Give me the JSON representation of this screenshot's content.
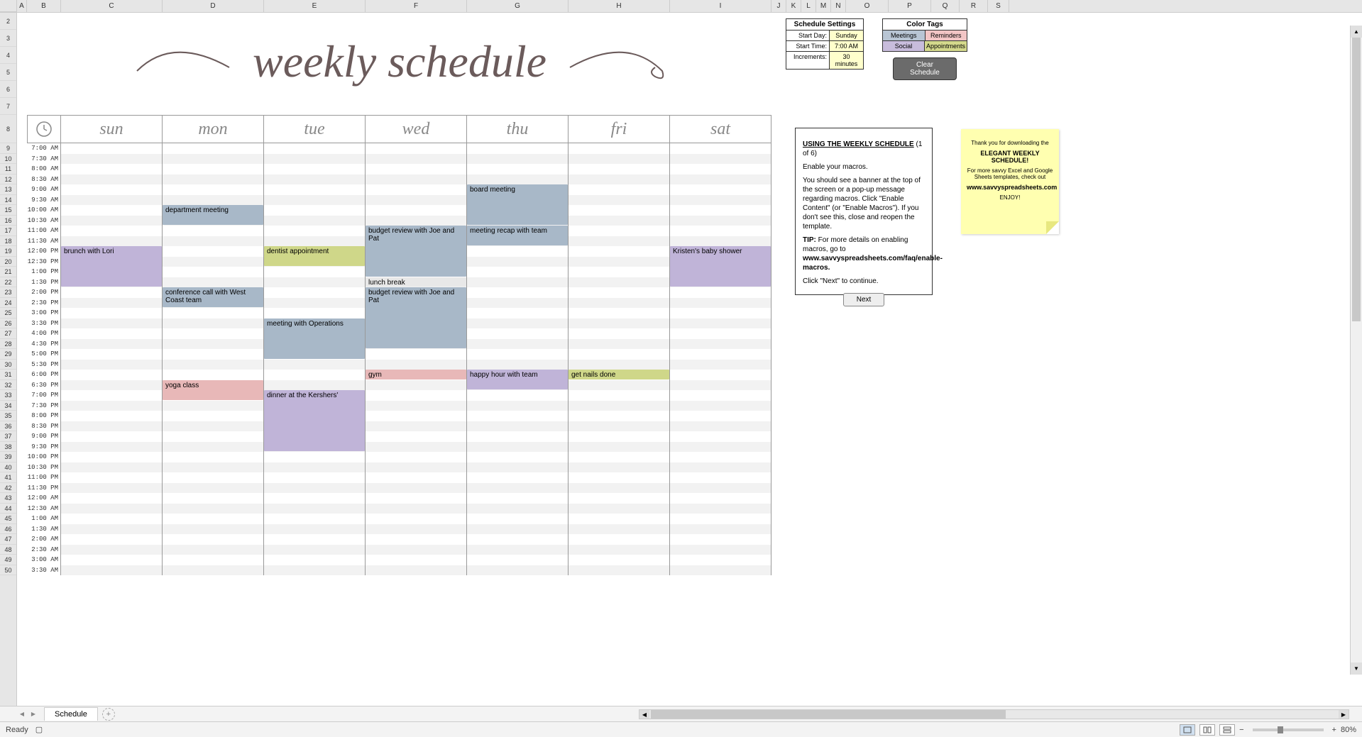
{
  "sheet_tab": "Schedule",
  "status_text": "Ready",
  "zoom_pct": "80%",
  "title_text": "weekly schedule",
  "columns": [
    "A",
    "B",
    "C",
    "D",
    "E",
    "F",
    "G",
    "H",
    "I",
    "J",
    "K",
    "L",
    "M",
    "N",
    "O",
    "P",
    "Q",
    "R",
    "S"
  ],
  "row_numbers_tall": "1",
  "row_day": "8",
  "row_numbers": [
    "2",
    "3",
    "4",
    "5",
    "6",
    "7",
    "9",
    "10",
    "11",
    "12",
    "13",
    "14",
    "15",
    "16",
    "17",
    "18",
    "19",
    "20",
    "21",
    "22",
    "23",
    "24",
    "25",
    "26",
    "27",
    "28",
    "29",
    "30",
    "31",
    "32",
    "33",
    "34",
    "35",
    "36",
    "37",
    "38",
    "39",
    "40",
    "41",
    "42",
    "43",
    "44",
    "45",
    "46",
    "47",
    "48",
    "49",
    "50"
  ],
  "settings": {
    "header": "Schedule Settings",
    "rows": [
      {
        "label": "Start Day:",
        "value": "Sunday"
      },
      {
        "label": "Start Time:",
        "value": "7:00 AM"
      },
      {
        "label": "Increments:",
        "value": "30 minutes"
      }
    ]
  },
  "colortags": {
    "header": "Color Tags",
    "tags": [
      "Meetings",
      "Reminders",
      "Social",
      "Appointments"
    ]
  },
  "clear_button": "Clear Schedule",
  "days": [
    "sun",
    "mon",
    "tue",
    "wed",
    "thu",
    "fri",
    "sat"
  ],
  "times": [
    "7:00 AM",
    "7:30 AM",
    "8:00 AM",
    "8:30 AM",
    "9:00 AM",
    "9:30 AM",
    "10:00 AM",
    "10:30 AM",
    "11:00 AM",
    "11:30 AM",
    "12:00 PM",
    "12:30 PM",
    "1:00 PM",
    "1:30 PM",
    "2:00 PM",
    "2:30 PM",
    "3:00 PM",
    "3:30 PM",
    "4:00 PM",
    "4:30 PM",
    "5:00 PM",
    "5:30 PM",
    "6:00 PM",
    "6:30 PM",
    "7:00 PM",
    "7:30 PM",
    "8:00 PM",
    "8:30 PM",
    "9:00 PM",
    "9:30 PM",
    "10:00 PM",
    "10:30 PM",
    "11:00 PM",
    "11:30 PM",
    "12:00 AM",
    "12:30 AM",
    "1:00 AM",
    "1:30 AM",
    "2:00 AM",
    "2:30 AM",
    "3:00 AM",
    "3:30 AM"
  ],
  "events": [
    {
      "text": "brunch with Lori",
      "day": 0,
      "start": 10,
      "span": 4,
      "color": "social"
    },
    {
      "text": "department meeting",
      "day": 1,
      "start": 6,
      "span": 2,
      "color": "meetings"
    },
    {
      "text": "conference call with West Coast team",
      "day": 1,
      "start": 14,
      "span": 2,
      "color": "meetings"
    },
    {
      "text": "yoga class",
      "day": 1,
      "start": 23,
      "span": 2,
      "color": "reminders"
    },
    {
      "text": "dentist appointment",
      "day": 2,
      "start": 10,
      "span": 2,
      "color": "appointments"
    },
    {
      "text": "meeting with Operations",
      "day": 2,
      "start": 17,
      "span": 4,
      "color": "meetings"
    },
    {
      "text": "dinner at the Kershers'",
      "day": 2,
      "start": 24,
      "span": 6,
      "color": "social"
    },
    {
      "text": "budget review with Joe and Pat",
      "day": 3,
      "start": 8,
      "span": 5,
      "color": "meetings"
    },
    {
      "text": "lunch break",
      "day": 3,
      "start": 13,
      "span": 1,
      "color": "lunch"
    },
    {
      "text": "budget review with Joe and Pat",
      "day": 3,
      "start": 14,
      "span": 6,
      "color": "meetings"
    },
    {
      "text": "gym",
      "day": 3,
      "start": 22,
      "span": 1,
      "color": "reminders"
    },
    {
      "text": "board meeting",
      "day": 4,
      "start": 4,
      "span": 4,
      "color": "meetings"
    },
    {
      "text": "meeting recap with team",
      "day": 4,
      "start": 8,
      "span": 2,
      "color": "meetings"
    },
    {
      "text": "happy hour with team",
      "day": 4,
      "start": 22,
      "span": 2,
      "color": "social"
    },
    {
      "text": "get nails done",
      "day": 5,
      "start": 22,
      "span": 1,
      "color": "appointments"
    },
    {
      "text": "Kristen's baby shower",
      "day": 6,
      "start": 10,
      "span": 4,
      "color": "social"
    }
  ],
  "help": {
    "title": "USING THE WEEKLY SCHEDULE",
    "page": "(1 of 6)",
    "p1": "Enable your macros.",
    "p2": "You should see a banner at the top of the screen or a pop-up message regarding macros. Click \"Enable Content\" (or \"Enable Macros\"). If you don't see this, close and reopen the template.",
    "p3_label": "TIP:",
    "p3": "For more details on enabling macros, go to",
    "p3_link": "www.savvyspreadsheets.com/faq/enable-macros.",
    "p4": "Click \"Next\" to continue.",
    "next": "Next"
  },
  "sticky": {
    "l1": "Thank you for downloading the",
    "l2": "ELEGANT WEEKLY SCHEDULE!",
    "l3": "For more savvy Excel and Google Sheets templates, check out",
    "l4": "www.savvyspreadsheets.com",
    "l5": "ENJOY!"
  }
}
